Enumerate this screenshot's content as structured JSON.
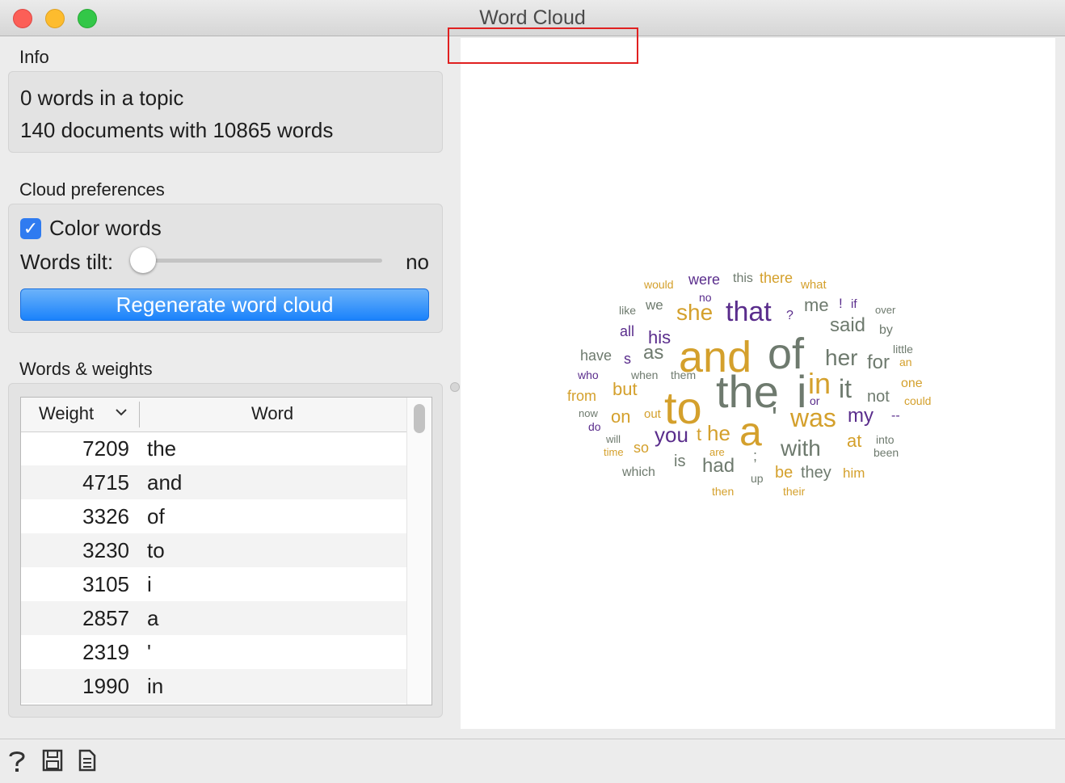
{
  "window": {
    "title": "Word Cloud"
  },
  "info": {
    "label": "Info",
    "line1": "0 words in a topic",
    "line2": "140 documents with 10865 words"
  },
  "prefs": {
    "label": "Cloud preferences",
    "color_words_label": "Color words",
    "color_words_checked": true,
    "tilt_label": "Words tilt:",
    "tilt_value": "no",
    "regenerate_label": "Regenerate word cloud"
  },
  "weights": {
    "label": "Words & weights",
    "col_weight": "Weight",
    "col_word": "Word",
    "rows": [
      {
        "weight": "7209",
        "word": "the"
      },
      {
        "weight": "4715",
        "word": "and"
      },
      {
        "weight": "3326",
        "word": "of"
      },
      {
        "weight": "3230",
        "word": "to"
      },
      {
        "weight": "3105",
        "word": "i"
      },
      {
        "weight": "2857",
        "word": "a"
      },
      {
        "weight": "2319",
        "word": "'"
      },
      {
        "weight": "1990",
        "word": "in"
      }
    ]
  },
  "cloud": {
    "colors": {
      "gray": "#6e7a6e",
      "gold": "#d4a02c",
      "purple": "#5a2d8c"
    },
    "words": [
      "and",
      "of",
      "the",
      "to",
      "a",
      "i",
      "in",
      "'",
      "was",
      "it",
      "that",
      "she",
      "her",
      "with",
      "you",
      "he",
      "as",
      "his",
      "on",
      "but",
      "had",
      "for",
      "my",
      "at",
      "not",
      "said",
      "me",
      "be",
      "they",
      "so",
      "is",
      "were",
      "there",
      "this",
      "what",
      "would",
      "we",
      "like",
      "all",
      "have",
      "s",
      "who",
      "when",
      "them",
      "from",
      "now",
      "do",
      "out",
      "will",
      "time",
      "are",
      "which",
      "then",
      "up",
      "their",
      "him",
      "into",
      "been",
      "could",
      "one",
      "an",
      "little",
      "by",
      "over",
      "if",
      "!",
      "no",
      "?",
      "or",
      ";",
      "--",
      "t"
    ]
  },
  "bottom": {
    "icons": [
      "help-icon",
      "save-icon",
      "report-icon"
    ]
  }
}
